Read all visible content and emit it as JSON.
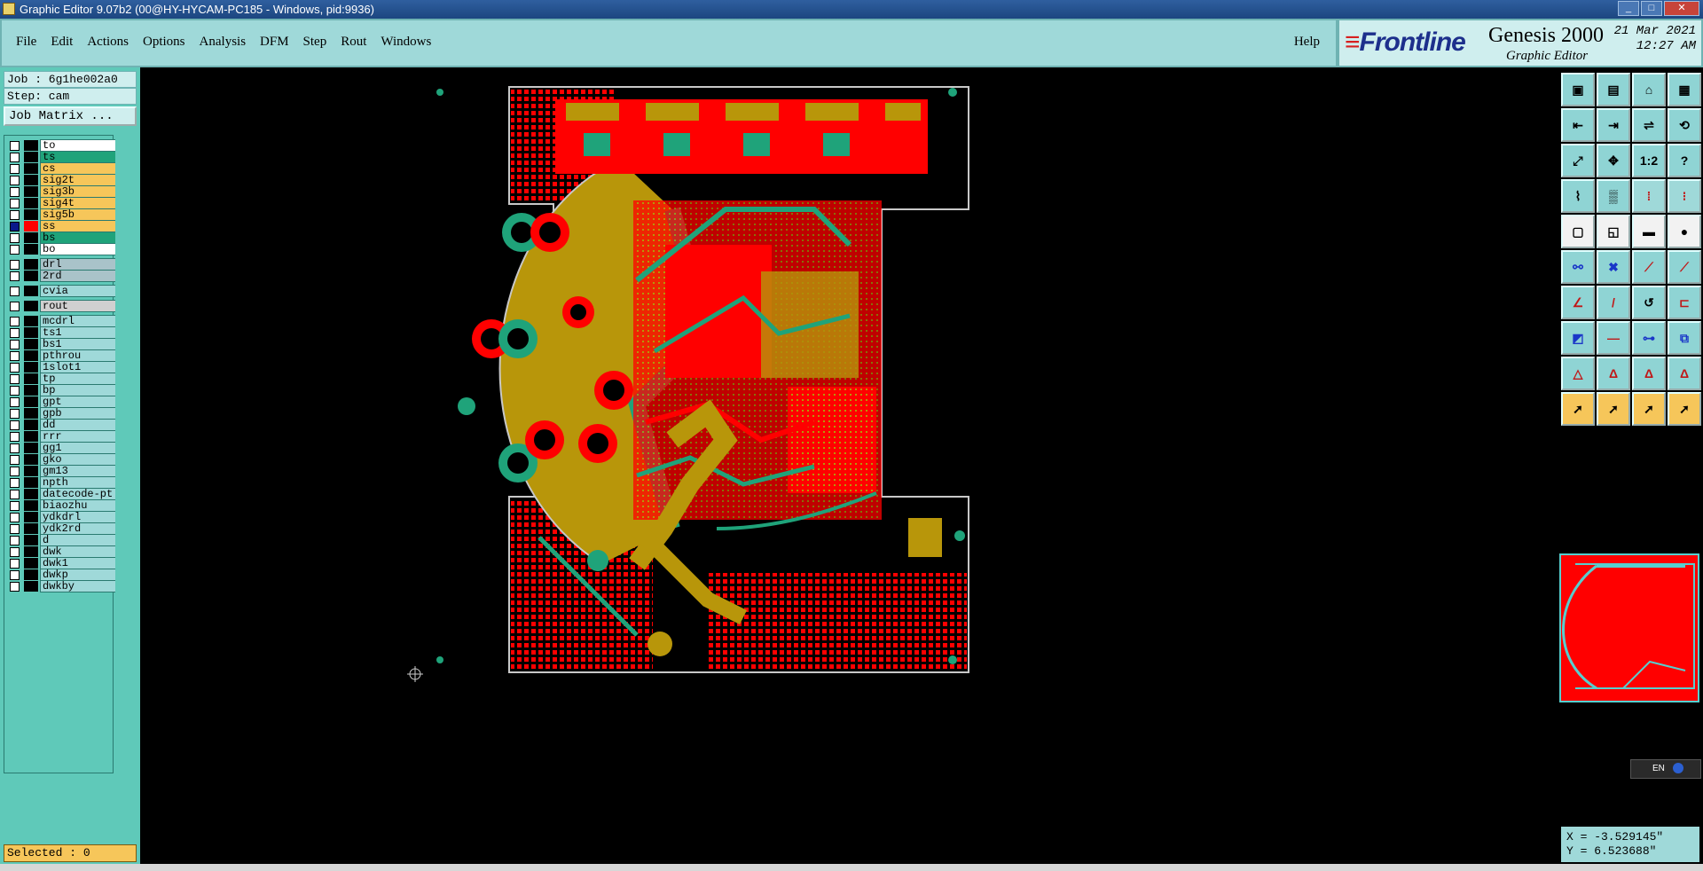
{
  "window": {
    "title": "Graphic Editor 9.07b2 (00@HY-HYCAM-PC185 - Windows, pid:9936)"
  },
  "menubar": {
    "items": [
      "File",
      "Edit",
      "Actions",
      "Options",
      "Analysis",
      "DFM",
      "Step",
      "Rout",
      "Windows"
    ],
    "help": "Help"
  },
  "brand": {
    "logo": "Frontline",
    "product": "Genesis 2000",
    "subtitle": "Graphic Editor",
    "date": "21 Mar 2021",
    "time": "12:27 AM"
  },
  "job": {
    "job_line": "Job : 6g1he002a0",
    "step_line": "Step: cam",
    "matrix_button": "Job Matrix ..."
  },
  "layers": [
    {
      "name": "to",
      "color": "#ffffff",
      "checked": false,
      "has_mark": true
    },
    {
      "name": "ts",
      "color": "#1fa37a",
      "checked": false,
      "has_mark": true
    },
    {
      "name": "cs",
      "color": "#f6c65a",
      "checked": false,
      "has_mark": true
    },
    {
      "name": "sig2t",
      "color": "#f6c65a",
      "checked": false,
      "has_mark": true
    },
    {
      "name": "sig3b",
      "color": "#f6c65a",
      "checked": false,
      "has_mark": true
    },
    {
      "name": "sig4t",
      "color": "#f6c65a",
      "checked": false,
      "has_mark": true
    },
    {
      "name": "sig5b",
      "color": "#f6c65a",
      "checked": false,
      "has_mark": true
    },
    {
      "name": "ss",
      "color": "#f6c65a",
      "checked": true,
      "has_mark": true
    },
    {
      "name": "bs",
      "color": "#1fa37a",
      "checked": false,
      "has_mark": true
    },
    {
      "name": "bo",
      "color": "#ffffff",
      "checked": false,
      "has_mark": true
    },
    {
      "name": "drl",
      "color": "#a9c3c9",
      "checked": false,
      "has_mark": false
    },
    {
      "name": "2rd",
      "color": "#a9c3c9",
      "checked": false,
      "has_mark": false
    },
    {
      "name": "cvia",
      "color": "#9fd9d9",
      "checked": false,
      "has_mark": false
    },
    {
      "name": "rout",
      "color": "#d0d0d0",
      "checked": false,
      "has_mark": false
    },
    {
      "name": "mcdrl",
      "color": "#9fd9d9",
      "checked": false,
      "has_mark": false
    },
    {
      "name": "ts1",
      "color": "#9fd9d9",
      "checked": false,
      "has_mark": false
    },
    {
      "name": "bs1",
      "color": "#9fd9d9",
      "checked": false,
      "has_mark": false
    },
    {
      "name": "pthrou",
      "color": "#9fd9d9",
      "checked": false,
      "has_mark": false
    },
    {
      "name": "1slot1",
      "color": "#9fd9d9",
      "checked": false,
      "has_mark": false
    },
    {
      "name": "tp",
      "color": "#9fd9d9",
      "checked": false,
      "has_mark": false
    },
    {
      "name": "bp",
      "color": "#9fd9d9",
      "checked": false,
      "has_mark": false
    },
    {
      "name": "gpt",
      "color": "#9fd9d9",
      "checked": false,
      "has_mark": false
    },
    {
      "name": "gpb",
      "color": "#9fd9d9",
      "checked": false,
      "has_mark": false
    },
    {
      "name": "dd",
      "color": "#9fd9d9",
      "checked": false,
      "has_mark": true
    },
    {
      "name": "rrr",
      "color": "#9fd9d9",
      "checked": false,
      "has_mark": false
    },
    {
      "name": "gg1",
      "color": "#9fd9d9",
      "checked": false,
      "has_mark": false
    },
    {
      "name": "gko",
      "color": "#9fd9d9",
      "checked": false,
      "has_mark": true
    },
    {
      "name": "gm13",
      "color": "#9fd9d9",
      "checked": false,
      "has_mark": false
    },
    {
      "name": "npth",
      "color": "#9fd9d9",
      "checked": false,
      "has_mark": false
    },
    {
      "name": "datecode-pt",
      "color": "#9fd9d9",
      "checked": false,
      "has_mark": false
    },
    {
      "name": "biaozhu",
      "color": "#9fd9d9",
      "checked": false,
      "has_mark": false
    },
    {
      "name": "ydkdrl",
      "color": "#9fd9d9",
      "checked": false,
      "has_mark": false
    },
    {
      "name": "ydk2rd",
      "color": "#9fd9d9",
      "checked": false,
      "has_mark": false
    },
    {
      "name": "d",
      "color": "#9fd9d9",
      "checked": false,
      "has_mark": false
    },
    {
      "name": "dwk",
      "color": "#9fd9d9",
      "checked": false,
      "has_mark": false
    },
    {
      "name": "dwk1",
      "color": "#9fd9d9",
      "checked": false,
      "has_mark": false
    },
    {
      "name": "dwkp",
      "color": "#9fd9d9",
      "checked": false,
      "has_mark": false
    },
    {
      "name": "dwkby",
      "color": "#9fd9d9",
      "checked": false,
      "has_mark": false
    }
  ],
  "status": {
    "selected": "Selected : 0"
  },
  "coords": {
    "x": "X = -3.529145\"",
    "y": "Y =  6.523688\""
  },
  "ime": {
    "label": "EN"
  },
  "toolbar": {
    "tools": [
      {
        "icon": "job-save-icon",
        "glyph": "▣",
        "style": "c1"
      },
      {
        "icon": "step-save-icon",
        "glyph": "▤",
        "style": "c1"
      },
      {
        "icon": "home-icon",
        "glyph": "⌂",
        "style": "c1"
      },
      {
        "icon": "window-layout-icon",
        "glyph": "▦",
        "style": "c1"
      },
      {
        "icon": "zoom-in-icon",
        "glyph": "⇤",
        "style": "c1"
      },
      {
        "icon": "zoom-out-icon",
        "glyph": "⇥",
        "style": "c1"
      },
      {
        "icon": "pan-icon",
        "glyph": "⇌",
        "style": "c1"
      },
      {
        "icon": "route-icon",
        "glyph": "⟲",
        "style": "c1"
      },
      {
        "icon": "zoom-fit-icon",
        "glyph": "⤢",
        "style": "c1"
      },
      {
        "icon": "zoom-area-icon",
        "glyph": "✥",
        "style": "c1"
      },
      {
        "icon": "scale-icon",
        "glyph": "1:2",
        "style": "c1"
      },
      {
        "icon": "help-icon",
        "glyph": "?",
        "style": "c1"
      },
      {
        "icon": "snap-icon",
        "glyph": "⌇",
        "style": "c1"
      },
      {
        "icon": "grid-icon",
        "glyph": "▒",
        "style": "c1"
      },
      {
        "icon": "layer-compare-icon",
        "glyph": "⁞",
        "style": "c3"
      },
      {
        "icon": "layer-filter-icon",
        "glyph": "⁝",
        "style": "c3"
      },
      {
        "icon": "pad-icon",
        "glyph": "▢",
        "style": "c2"
      },
      {
        "icon": "line-tool-icon",
        "glyph": "◱",
        "style": "c2"
      },
      {
        "icon": "ruler-icon",
        "glyph": "▬",
        "style": "c2"
      },
      {
        "icon": "dot-icon",
        "glyph": "●",
        "style": "c2"
      },
      {
        "icon": "connect-icon",
        "glyph": "⚯",
        "style": "c1 blue"
      },
      {
        "icon": "cross-icon",
        "glyph": "✖",
        "style": "c1 blue"
      },
      {
        "icon": "node-icon",
        "glyph": "⟋",
        "style": "c1 red"
      },
      {
        "icon": "node-move-icon",
        "glyph": "⟋",
        "style": "c1 red"
      },
      {
        "icon": "angle-icon",
        "glyph": "∠",
        "style": "c1 red"
      },
      {
        "icon": "slash-icon",
        "glyph": "/",
        "style": "c1 red"
      },
      {
        "icon": "arc-icon",
        "glyph": "↺",
        "style": "c1"
      },
      {
        "icon": "bracket-icon",
        "glyph": "⊏",
        "style": "c1 red"
      },
      {
        "icon": "point-line-icon",
        "glyph": "◩",
        "style": "c1 blue"
      },
      {
        "icon": "dash-icon",
        "glyph": "—",
        "style": "c1 red"
      },
      {
        "icon": "measure-icon",
        "glyph": "⊶",
        "style": "c1 blue"
      },
      {
        "icon": "shapes-icon",
        "glyph": "⧉",
        "style": "c1 blue"
      },
      {
        "icon": "triangle-icon",
        "glyph": "△",
        "style": "c1 red"
      },
      {
        "icon": "triangle-a-icon",
        "glyph": "Δ",
        "style": "c1 red"
      },
      {
        "icon": "triangle-b-icon",
        "glyph": "Δ",
        "style": "c1 red"
      },
      {
        "icon": "triangle-c-icon",
        "glyph": "Δ",
        "style": "c1 red"
      },
      {
        "icon": "pointer-icon",
        "glyph": "➚",
        "style": "c4"
      },
      {
        "icon": "pointer-box-icon",
        "glyph": "➚",
        "style": "c4"
      },
      {
        "icon": "pointer-edit-icon",
        "glyph": "➚",
        "style": "c4"
      },
      {
        "icon": "pointer-route-icon",
        "glyph": "➚",
        "style": "c4"
      }
    ]
  }
}
